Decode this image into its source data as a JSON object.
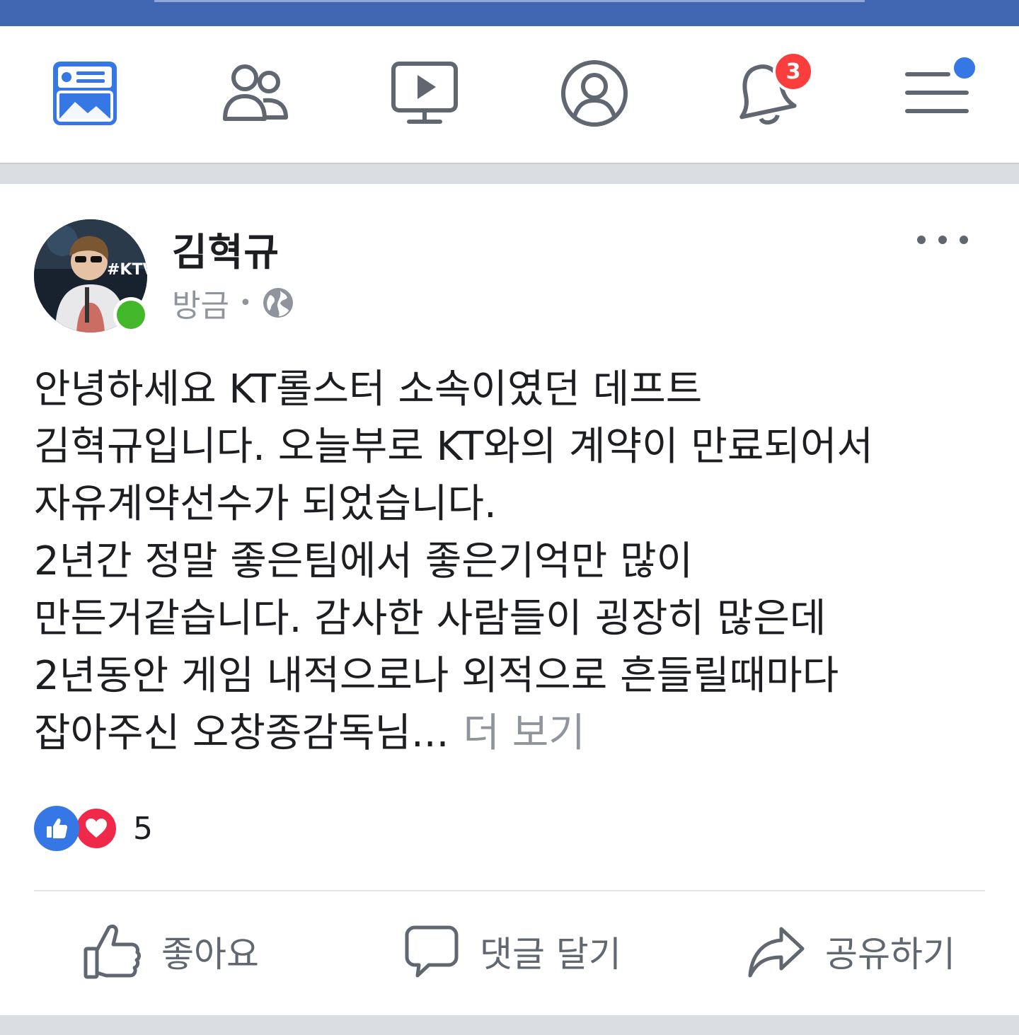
{
  "nav": {
    "items": [
      {
        "name": "news-feed",
        "icon": "news-feed-icon",
        "active": true
      },
      {
        "name": "friends",
        "icon": "friends-icon"
      },
      {
        "name": "watch",
        "icon": "watch-icon"
      },
      {
        "name": "profile",
        "icon": "profile-icon"
      },
      {
        "name": "notifications",
        "icon": "bell-icon",
        "badge": "3"
      },
      {
        "name": "menu",
        "icon": "menu-icon",
        "dot": true
      }
    ],
    "notification_badge": "3",
    "colors": {
      "brand": "#4267b2",
      "active": "#3578e5",
      "badge": "#fa3e3e",
      "icon": "#606770"
    }
  },
  "post": {
    "author": "김혁규",
    "time": "방금",
    "privacy_icon": "globe-icon",
    "online": true,
    "text": "안녕하세요 KT롤스터 소속이였던 데프트\n김혁규입니다. 오늘부로 KT와의 계약이 만료되어서\n자유계약선수가 되었습니다.\n2년간 정말 좋은팀에서 좋은기억만 많이\n만든거같습니다. 감사한 사람들이 굉장히 많은데\n2년동안 게임 내적으로나 외적으로 흔들릴때마다\n잡아주신 오창종감독님...",
    "see_more": "더 보기",
    "reactions": {
      "types": [
        "like",
        "love"
      ],
      "count": "5"
    },
    "actions": {
      "like": "좋아요",
      "comment": "댓글 달기",
      "share": "공유하기"
    },
    "avatar_text": "#KTV"
  }
}
